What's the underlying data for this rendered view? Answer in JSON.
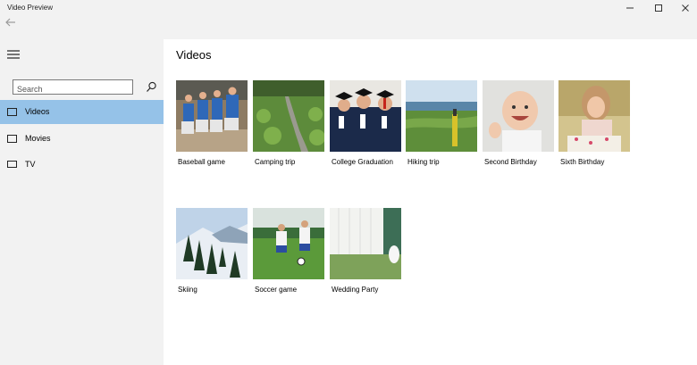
{
  "window": {
    "title": "Video Preview"
  },
  "sidebar": {
    "search_placeholder": "Search",
    "items": [
      {
        "label": "Videos",
        "icon": "video-icon",
        "selected": true
      },
      {
        "label": "Movies",
        "icon": "movie-icon",
        "selected": false
      },
      {
        "label": "TV",
        "icon": "tv-icon",
        "selected": false
      }
    ]
  },
  "main": {
    "title": "Videos",
    "videos": [
      {
        "title": "Baseball game"
      },
      {
        "title": "Camping trip"
      },
      {
        "title": "College Graduation"
      },
      {
        "title": "Hiking trip"
      },
      {
        "title": "Second Birthday"
      },
      {
        "title": "Sixth Birthday"
      },
      {
        "title": "Skiing"
      },
      {
        "title": "Soccer game"
      },
      {
        "title": "Wedding Party"
      }
    ]
  },
  "colors": {
    "selection": "#95c2e8",
    "chrome": "#f2f2f2"
  }
}
